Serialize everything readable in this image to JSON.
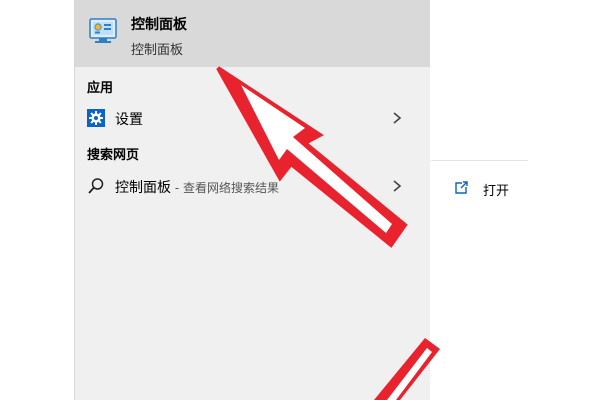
{
  "best_match": {
    "title": "控制面板",
    "subtitle": "控制面板",
    "icon": "control-panel-icon"
  },
  "apps": {
    "header": "应用",
    "items": [
      {
        "label": "设置",
        "icon": "settings-gear-icon"
      }
    ]
  },
  "web": {
    "header": "搜索网页",
    "items": [
      {
        "label": "控制面板",
        "suffix": " - 查看网络搜索结果",
        "icon": "search-icon"
      }
    ]
  },
  "detail": {
    "open_label": "打开",
    "open_icon": "open-external-icon"
  },
  "colors": {
    "arrow": "#e8232e",
    "selection_bg": "#d9d9d9",
    "list_bg": "#f0f0f0",
    "settings_blue": "#0a64c8"
  }
}
